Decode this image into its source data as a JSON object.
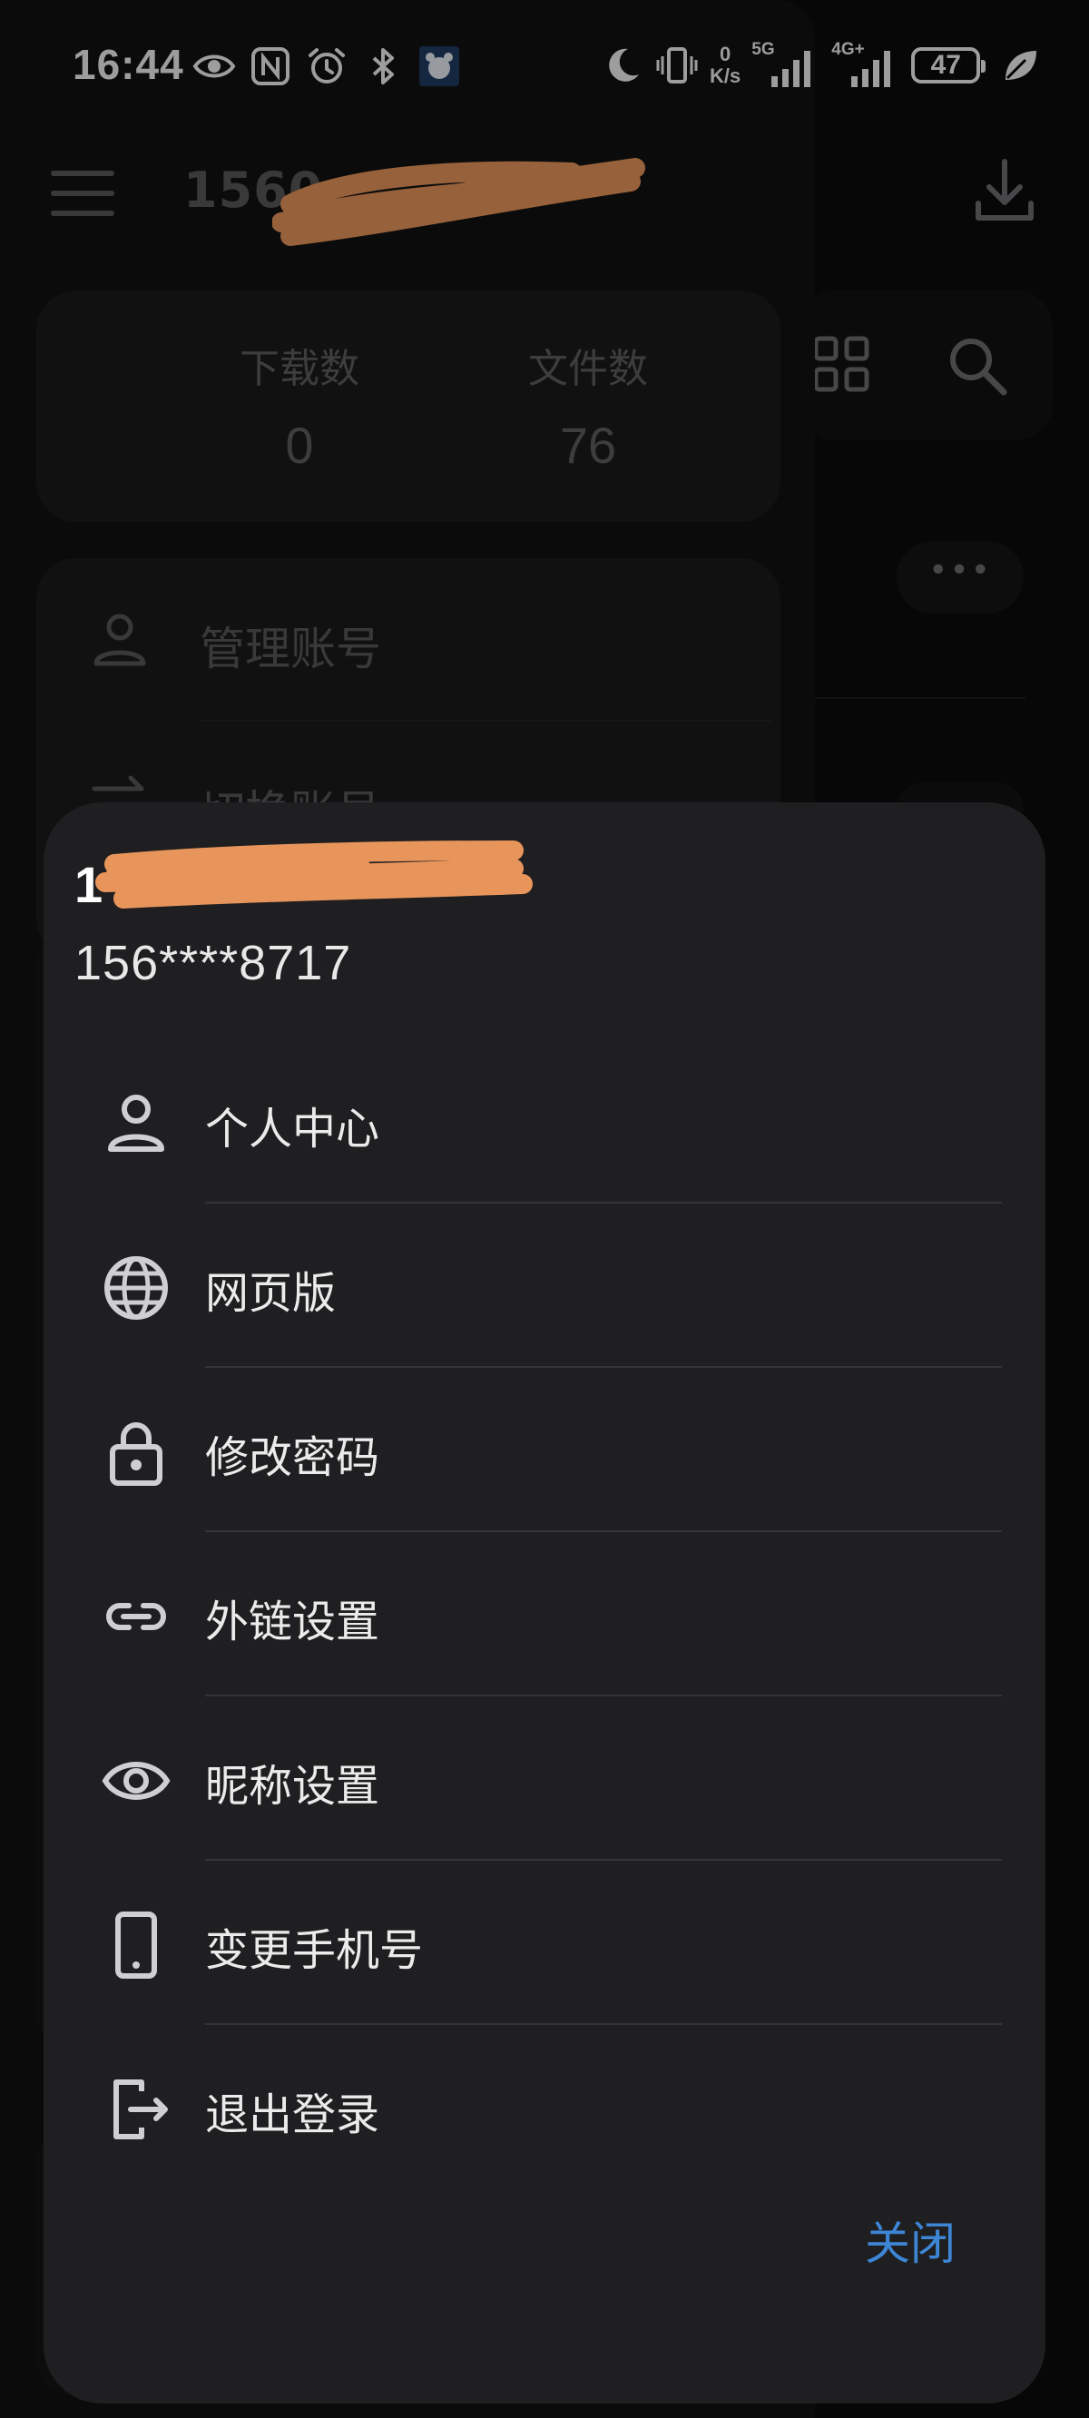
{
  "status_bar": {
    "time": "16:44",
    "net_speed_value": "0",
    "net_speed_unit": "K/s",
    "signal1_label": "5G",
    "signal2_label": "4G+",
    "battery_level": "47",
    "left_icons": [
      "eye-icon",
      "nfc-icon",
      "alarm-icon",
      "bluetooth-icon",
      "app-notification-icon"
    ],
    "right_icons": [
      "moon-icon",
      "vibrate-icon",
      "signal-5g-icon",
      "signal-4g-icon",
      "battery-icon",
      "leaf-icon"
    ]
  },
  "background": {
    "drawer_title_visible": "1560",
    "stats": [
      {
        "label": "下载数",
        "value": "0"
      },
      {
        "label": "文件数",
        "value": "76"
      }
    ],
    "account_rows": [
      {
        "label": "管理账号",
        "icon": "person-icon"
      },
      {
        "label": "切换账号",
        "icon": "swap-icon"
      }
    ],
    "more_label": "•••"
  },
  "sheet": {
    "account_name_visible": "1",
    "phone_masked": "156****8717",
    "items": [
      {
        "label": "个人中心",
        "icon": "person-icon"
      },
      {
        "label": "网页版",
        "icon": "globe-icon"
      },
      {
        "label": "修改密码",
        "icon": "lock-icon"
      },
      {
        "label": "外链设置",
        "icon": "link-icon"
      },
      {
        "label": "昵称设置",
        "icon": "eye-icon"
      },
      {
        "label": "变更手机号",
        "icon": "phone-icon"
      },
      {
        "label": "退出登录",
        "icon": "logout-icon"
      }
    ],
    "close_label": "关闭",
    "accent_color": "#3d86d6"
  }
}
